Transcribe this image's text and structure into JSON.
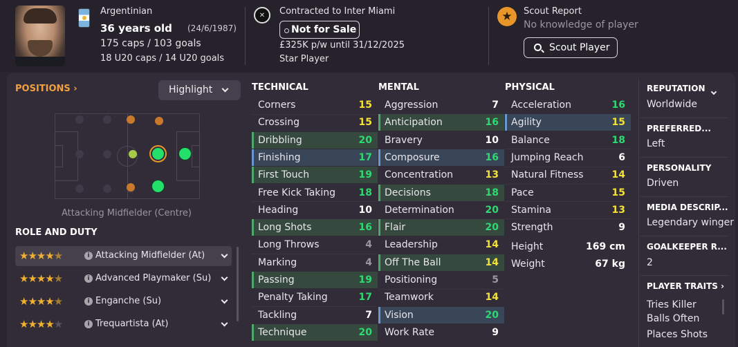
{
  "header": {
    "nationality": "Argentinian",
    "age": "36 years old",
    "dob": "(24/6/1987)",
    "caps": "175 caps / 103 goals",
    "u20_caps": "18 U20 caps / 14 U20 goals",
    "contract": "Contracted to Inter Miami",
    "sale_status": "Not for Sale",
    "wage": "£325K p/w until 31/12/2025",
    "status": "Star Player",
    "scout_title": "Scout Report",
    "scout_note": "No knowledge of player",
    "scout_button": "Scout Player"
  },
  "left": {
    "positions_label": "POSITIONS",
    "highlight_label": "Highlight",
    "position_caption": "Attacking Midfielder (Centre)",
    "role_title": "ROLE AND DUTY",
    "roles": [
      {
        "stars": "★★★★",
        "half": "★",
        "off": "",
        "name": "Attacking Midfielder (At)"
      },
      {
        "stars": "★★★★",
        "half": "★",
        "off": "",
        "name": "Advanced Playmaker (Su)"
      },
      {
        "stars": "★★★★",
        "half": "★",
        "off": "",
        "name": "Enganche (Su)"
      },
      {
        "stars": "★★★★",
        "half": "",
        "off": "★",
        "name": "Trequartista (At)"
      }
    ]
  },
  "technical": {
    "title": "TECHNICAL",
    "items": [
      {
        "name": "Corners",
        "value": "15"
      },
      {
        "name": "Crossing",
        "value": "15"
      },
      {
        "name": "Dribbling",
        "value": "20"
      },
      {
        "name": "Finishing",
        "value": "17"
      },
      {
        "name": "First Touch",
        "value": "19"
      },
      {
        "name": "Free Kick Taking",
        "value": "18"
      },
      {
        "name": "Heading",
        "value": "10"
      },
      {
        "name": "Long Shots",
        "value": "16"
      },
      {
        "name": "Long Throws",
        "value": "4"
      },
      {
        "name": "Marking",
        "value": "4"
      },
      {
        "name": "Passing",
        "value": "19"
      },
      {
        "name": "Penalty Taking",
        "value": "17"
      },
      {
        "name": "Tackling",
        "value": "7"
      },
      {
        "name": "Technique",
        "value": "20"
      }
    ]
  },
  "mental": {
    "title": "MENTAL",
    "items": [
      {
        "name": "Aggression",
        "value": "7"
      },
      {
        "name": "Anticipation",
        "value": "16"
      },
      {
        "name": "Bravery",
        "value": "10"
      },
      {
        "name": "Composure",
        "value": "16"
      },
      {
        "name": "Concentration",
        "value": "13"
      },
      {
        "name": "Decisions",
        "value": "18"
      },
      {
        "name": "Determination",
        "value": "20"
      },
      {
        "name": "Flair",
        "value": "20"
      },
      {
        "name": "Leadership",
        "value": "14"
      },
      {
        "name": "Off The Ball",
        "value": "14"
      },
      {
        "name": "Positioning",
        "value": "5"
      },
      {
        "name": "Teamwork",
        "value": "14"
      },
      {
        "name": "Vision",
        "value": "20"
      },
      {
        "name": "Work Rate",
        "value": "9"
      }
    ]
  },
  "physical": {
    "title": "PHYSICAL",
    "items": [
      {
        "name": "Acceleration",
        "value": "16"
      },
      {
        "name": "Agility",
        "value": "15"
      },
      {
        "name": "Balance",
        "value": "18"
      },
      {
        "name": "Jumping Reach",
        "value": "6"
      },
      {
        "name": "Natural Fitness",
        "value": "14"
      },
      {
        "name": "Pace",
        "value": "15"
      },
      {
        "name": "Stamina",
        "value": "13"
      },
      {
        "name": "Strength",
        "value": "9"
      }
    ],
    "height_label": "Height",
    "height_value": "169 cm",
    "weight_label": "Weight",
    "weight_value": "67 kg"
  },
  "info": {
    "reputation_label": "REPUTATION",
    "reputation_value": "Worldwide",
    "foot_label": "PREFERRED...",
    "foot_value": "Left",
    "personality_label": "PERSONALITY",
    "personality_value": "Driven",
    "media_label": "MEDIA DESCRIP...",
    "media_value": "Legendary winger",
    "gk_label": "GOALKEEPER R...",
    "gk_value": "2",
    "traits_label": "PLAYER TRAITS",
    "traits_value_1": "Tries Killer",
    "traits_value_2": "Balls Often",
    "traits_value_3": "Places Shots"
  },
  "colors": {
    "high": "#2fd972",
    "mid": "#f2e23a",
    "normal": "#ffffff",
    "low": "#9a96a0",
    "accent": "#e8952a"
  }
}
